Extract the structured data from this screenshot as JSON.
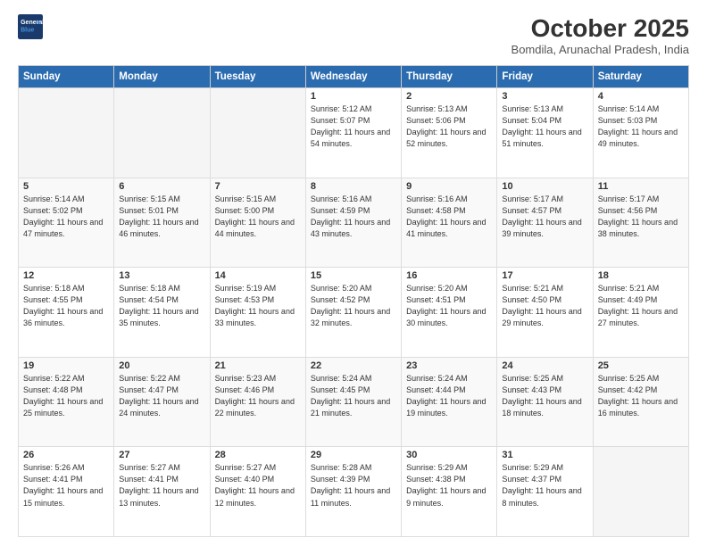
{
  "logo": {
    "line1": "General",
    "line2": "Blue"
  },
  "header": {
    "title": "October 2025",
    "subtitle": "Bomdila, Arunachal Pradesh, India"
  },
  "weekdays": [
    "Sunday",
    "Monday",
    "Tuesday",
    "Wednesday",
    "Thursday",
    "Friday",
    "Saturday"
  ],
  "weeks": [
    [
      {
        "day": "",
        "sunrise": "",
        "sunset": "",
        "daylight": ""
      },
      {
        "day": "",
        "sunrise": "",
        "sunset": "",
        "daylight": ""
      },
      {
        "day": "",
        "sunrise": "",
        "sunset": "",
        "daylight": ""
      },
      {
        "day": "1",
        "sunrise": "Sunrise: 5:12 AM",
        "sunset": "Sunset: 5:07 PM",
        "daylight": "Daylight: 11 hours and 54 minutes."
      },
      {
        "day": "2",
        "sunrise": "Sunrise: 5:13 AM",
        "sunset": "Sunset: 5:06 PM",
        "daylight": "Daylight: 11 hours and 52 minutes."
      },
      {
        "day": "3",
        "sunrise": "Sunrise: 5:13 AM",
        "sunset": "Sunset: 5:04 PM",
        "daylight": "Daylight: 11 hours and 51 minutes."
      },
      {
        "day": "4",
        "sunrise": "Sunrise: 5:14 AM",
        "sunset": "Sunset: 5:03 PM",
        "daylight": "Daylight: 11 hours and 49 minutes."
      }
    ],
    [
      {
        "day": "5",
        "sunrise": "Sunrise: 5:14 AM",
        "sunset": "Sunset: 5:02 PM",
        "daylight": "Daylight: 11 hours and 47 minutes."
      },
      {
        "day": "6",
        "sunrise": "Sunrise: 5:15 AM",
        "sunset": "Sunset: 5:01 PM",
        "daylight": "Daylight: 11 hours and 46 minutes."
      },
      {
        "day": "7",
        "sunrise": "Sunrise: 5:15 AM",
        "sunset": "Sunset: 5:00 PM",
        "daylight": "Daylight: 11 hours and 44 minutes."
      },
      {
        "day": "8",
        "sunrise": "Sunrise: 5:16 AM",
        "sunset": "Sunset: 4:59 PM",
        "daylight": "Daylight: 11 hours and 43 minutes."
      },
      {
        "day": "9",
        "sunrise": "Sunrise: 5:16 AM",
        "sunset": "Sunset: 4:58 PM",
        "daylight": "Daylight: 11 hours and 41 minutes."
      },
      {
        "day": "10",
        "sunrise": "Sunrise: 5:17 AM",
        "sunset": "Sunset: 4:57 PM",
        "daylight": "Daylight: 11 hours and 39 minutes."
      },
      {
        "day": "11",
        "sunrise": "Sunrise: 5:17 AM",
        "sunset": "Sunset: 4:56 PM",
        "daylight": "Daylight: 11 hours and 38 minutes."
      }
    ],
    [
      {
        "day": "12",
        "sunrise": "Sunrise: 5:18 AM",
        "sunset": "Sunset: 4:55 PM",
        "daylight": "Daylight: 11 hours and 36 minutes."
      },
      {
        "day": "13",
        "sunrise": "Sunrise: 5:18 AM",
        "sunset": "Sunset: 4:54 PM",
        "daylight": "Daylight: 11 hours and 35 minutes."
      },
      {
        "day": "14",
        "sunrise": "Sunrise: 5:19 AM",
        "sunset": "Sunset: 4:53 PM",
        "daylight": "Daylight: 11 hours and 33 minutes."
      },
      {
        "day": "15",
        "sunrise": "Sunrise: 5:20 AM",
        "sunset": "Sunset: 4:52 PM",
        "daylight": "Daylight: 11 hours and 32 minutes."
      },
      {
        "day": "16",
        "sunrise": "Sunrise: 5:20 AM",
        "sunset": "Sunset: 4:51 PM",
        "daylight": "Daylight: 11 hours and 30 minutes."
      },
      {
        "day": "17",
        "sunrise": "Sunrise: 5:21 AM",
        "sunset": "Sunset: 4:50 PM",
        "daylight": "Daylight: 11 hours and 29 minutes."
      },
      {
        "day": "18",
        "sunrise": "Sunrise: 5:21 AM",
        "sunset": "Sunset: 4:49 PM",
        "daylight": "Daylight: 11 hours and 27 minutes."
      }
    ],
    [
      {
        "day": "19",
        "sunrise": "Sunrise: 5:22 AM",
        "sunset": "Sunset: 4:48 PM",
        "daylight": "Daylight: 11 hours and 25 minutes."
      },
      {
        "day": "20",
        "sunrise": "Sunrise: 5:22 AM",
        "sunset": "Sunset: 4:47 PM",
        "daylight": "Daylight: 11 hours and 24 minutes."
      },
      {
        "day": "21",
        "sunrise": "Sunrise: 5:23 AM",
        "sunset": "Sunset: 4:46 PM",
        "daylight": "Daylight: 11 hours and 22 minutes."
      },
      {
        "day": "22",
        "sunrise": "Sunrise: 5:24 AM",
        "sunset": "Sunset: 4:45 PM",
        "daylight": "Daylight: 11 hours and 21 minutes."
      },
      {
        "day": "23",
        "sunrise": "Sunrise: 5:24 AM",
        "sunset": "Sunset: 4:44 PM",
        "daylight": "Daylight: 11 hours and 19 minutes."
      },
      {
        "day": "24",
        "sunrise": "Sunrise: 5:25 AM",
        "sunset": "Sunset: 4:43 PM",
        "daylight": "Daylight: 11 hours and 18 minutes."
      },
      {
        "day": "25",
        "sunrise": "Sunrise: 5:25 AM",
        "sunset": "Sunset: 4:42 PM",
        "daylight": "Daylight: 11 hours and 16 minutes."
      }
    ],
    [
      {
        "day": "26",
        "sunrise": "Sunrise: 5:26 AM",
        "sunset": "Sunset: 4:41 PM",
        "daylight": "Daylight: 11 hours and 15 minutes."
      },
      {
        "day": "27",
        "sunrise": "Sunrise: 5:27 AM",
        "sunset": "Sunset: 4:41 PM",
        "daylight": "Daylight: 11 hours and 13 minutes."
      },
      {
        "day": "28",
        "sunrise": "Sunrise: 5:27 AM",
        "sunset": "Sunset: 4:40 PM",
        "daylight": "Daylight: 11 hours and 12 minutes."
      },
      {
        "day": "29",
        "sunrise": "Sunrise: 5:28 AM",
        "sunset": "Sunset: 4:39 PM",
        "daylight": "Daylight: 11 hours and 11 minutes."
      },
      {
        "day": "30",
        "sunrise": "Sunrise: 5:29 AM",
        "sunset": "Sunset: 4:38 PM",
        "daylight": "Daylight: 11 hours and 9 minutes."
      },
      {
        "day": "31",
        "sunrise": "Sunrise: 5:29 AM",
        "sunset": "Sunset: 4:37 PM",
        "daylight": "Daylight: 11 hours and 8 minutes."
      },
      {
        "day": "",
        "sunrise": "",
        "sunset": "",
        "daylight": ""
      }
    ]
  ]
}
